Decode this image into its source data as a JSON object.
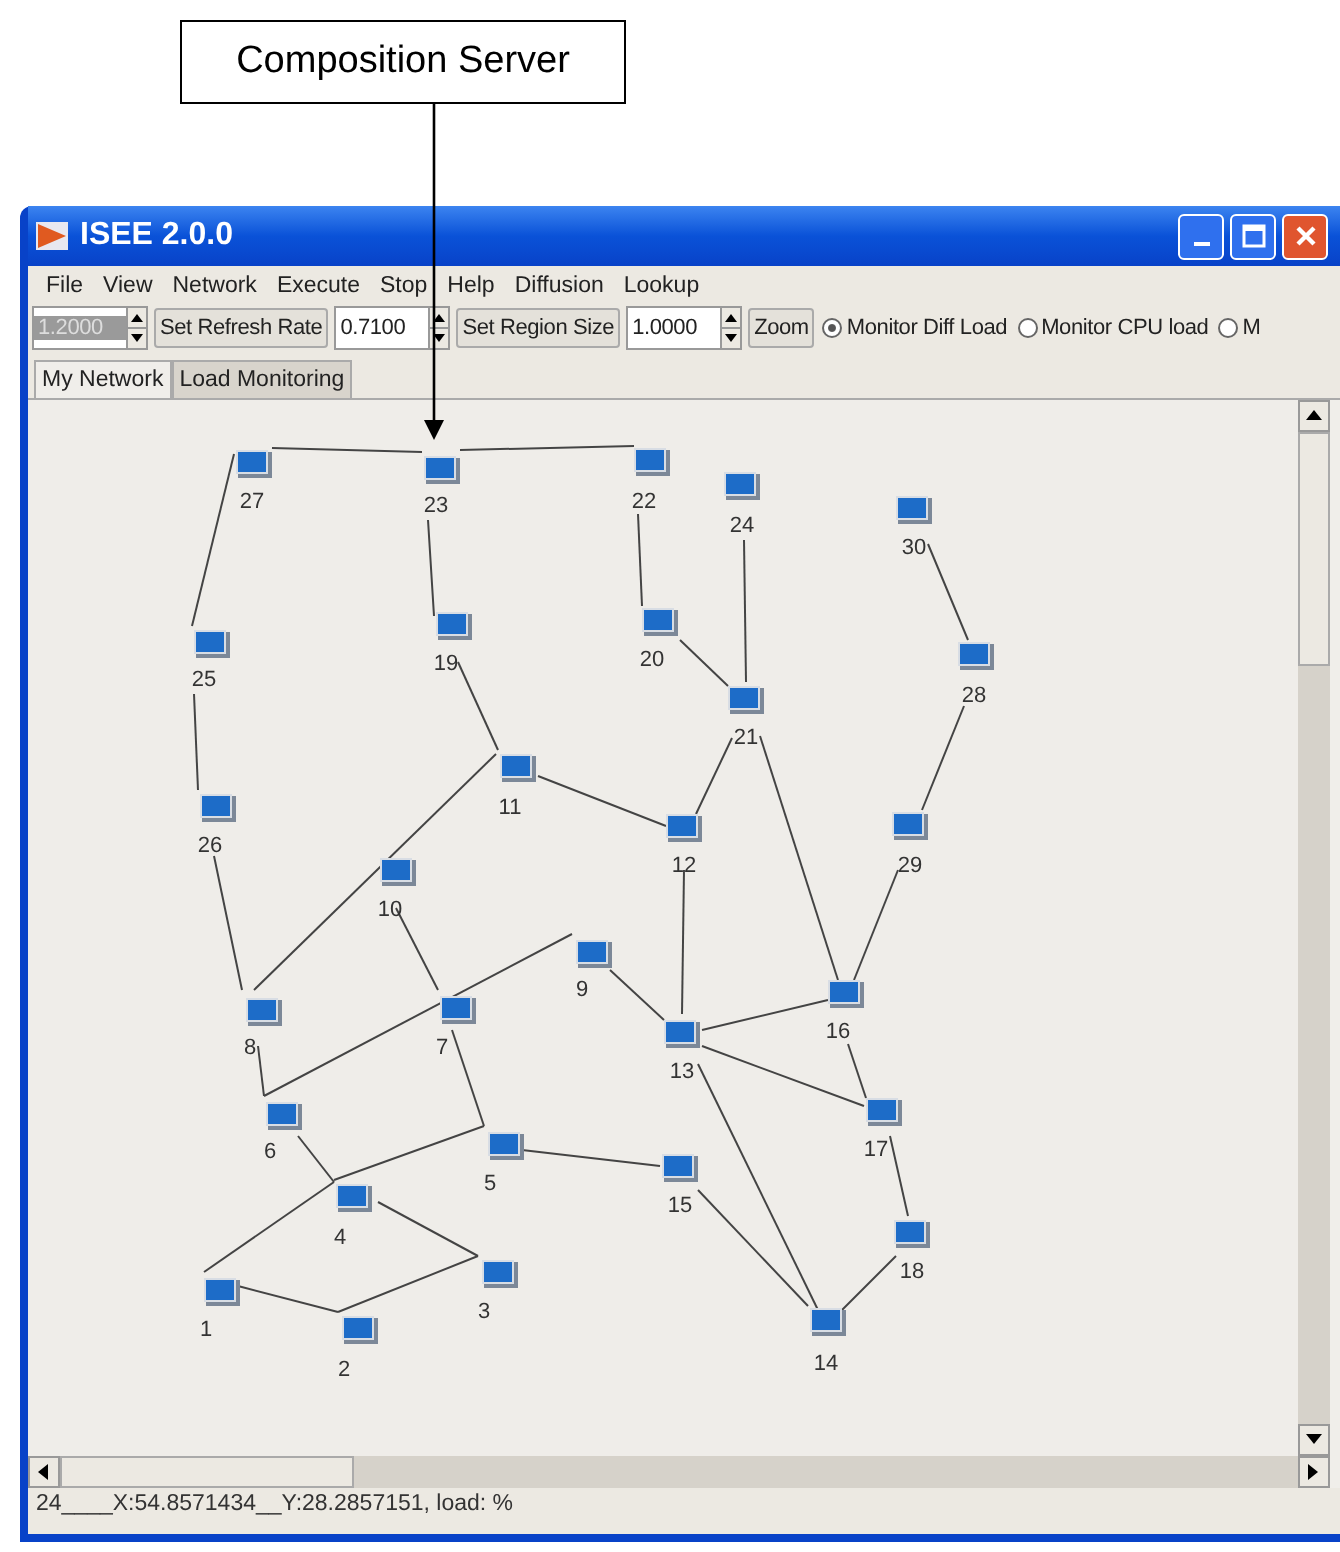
{
  "annotation": {
    "text": "Composition Server"
  },
  "window": {
    "title": "ISEE 2.0.0"
  },
  "menu": [
    "File",
    "View",
    "Network",
    "Execute",
    "Stop",
    "Help",
    "Diffusion",
    "Lookup"
  ],
  "toolbar": {
    "refresh_field": {
      "value": "1.2000",
      "disabled": true
    },
    "refresh_button": "Set Refresh Rate",
    "region_field": {
      "value": "0.7100",
      "disabled": false
    },
    "region_button": "Set Region Size",
    "zoom_field": {
      "value": "1.0000",
      "disabled": false
    },
    "zoom_button": "Zoom",
    "radios": [
      {
        "label": "Monitor Diff Load",
        "selected": true
      },
      {
        "label": "Monitor CPU load",
        "selected": false
      },
      {
        "label": "M",
        "selected": false
      }
    ]
  },
  "tabs": [
    {
      "label": "My Network",
      "selected": true
    },
    {
      "label": "Load Monitoring",
      "selected": false
    }
  ],
  "nodes": [
    {
      "label": "27"
    },
    {
      "label": "23"
    },
    {
      "label": "22"
    },
    {
      "label": "24"
    },
    {
      "label": "30"
    },
    {
      "label": "25"
    },
    {
      "label": "19"
    },
    {
      "label": "20"
    },
    {
      "label": "21"
    },
    {
      "label": "28"
    },
    {
      "label": "11"
    },
    {
      "label": "12"
    },
    {
      "label": "29"
    },
    {
      "label": "26"
    },
    {
      "label": "10"
    },
    {
      "label": "9"
    },
    {
      "label": "8"
    },
    {
      "label": "7"
    },
    {
      "label": "13"
    },
    {
      "label": "16"
    },
    {
      "label": "6"
    },
    {
      "label": "17"
    },
    {
      "label": "5"
    },
    {
      "label": "15"
    },
    {
      "label": "4"
    },
    {
      "label": "3"
    },
    {
      "label": "18"
    },
    {
      "label": "1"
    },
    {
      "label": "2"
    },
    {
      "label": "14"
    }
  ],
  "status_bar": "24____X:54.8571434__Y:28.2857151, load: %"
}
